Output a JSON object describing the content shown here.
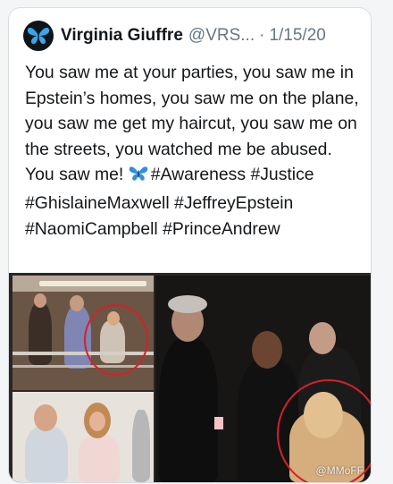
{
  "tweet": {
    "author_name": "Virginia Giuffre",
    "handle": "@VRS...",
    "separator": "·",
    "date": "1/15/20",
    "body_line_before_emoji": "You saw me at your parties, you saw me in Epstein’s homes, you saw me on the plane, you saw me get my haircut, you saw me on the streets, you watched me be abused. You saw me! ",
    "hashtags": "#Awareness #Justice #GhislaineMaxwell #JeffreyEpstein #NaomiCampbell #PrinceAndrew"
  },
  "media": {
    "watermark": "@MMoFF"
  },
  "icons": {
    "avatar": "butterfly-avatar-icon",
    "emoji": "blue-butterfly-icon"
  },
  "colors": {
    "text": "#14171a",
    "handle": "#657786",
    "butterfly": "#2f8fe0",
    "highlight_circle": "#d52028"
  }
}
